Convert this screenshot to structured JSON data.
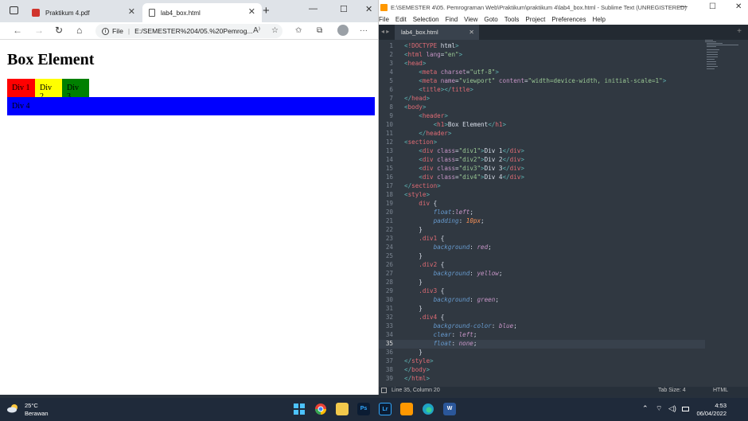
{
  "browser": {
    "tab1": "Praktikum 4.pdf",
    "tab2": "lab4_box.html",
    "url_prefix": "File",
    "url": "E:/SEMESTER%204/05.%20Pemrog...",
    "new_tab": "+",
    "close": "✕",
    "min": "—",
    "max": "☐",
    "back": "←",
    "fwd": "→",
    "refresh": "↻",
    "home": "⌂",
    "more": "···",
    "read_aloud": "A⁾",
    "fav": "☆",
    "favs": "✩",
    "coll": "⧉"
  },
  "page": {
    "heading": "Box Element",
    "div1": "Div 1",
    "div2": "Div 2",
    "div3": "Div 3",
    "div4": "Div 4"
  },
  "sublime": {
    "title": "E:\\SEMESTER 4\\05. Pemrograman Web\\Praktikum\\praktikum 4\\lab4_box.html - Sublime Text (UNREGISTERED)",
    "menu": [
      "File",
      "Edit",
      "Selection",
      "Find",
      "View",
      "Goto",
      "Tools",
      "Project",
      "Preferences",
      "Help"
    ],
    "tab": "lab4_box.html",
    "status_left": "Line 35, Column 20",
    "tab_size": "Tab Size: 4",
    "syntax": "HTML",
    "min": "—",
    "max": "☐",
    "close": "✕",
    "plus": "+",
    "nav": "◂ ▸"
  },
  "colors": {
    "tag": "#e06c75",
    "attr": "#c594c5",
    "str": "#99c794",
    "prop": "#6699cc",
    "val": "#c594c5",
    "num": "#f99157",
    "plain": "#d8dee9",
    "punc": "#5fb3b3"
  },
  "code": [
    "<!DOCTYPE html>",
    "<html lang=\"en\">",
    "<head>",
    "    <meta charset=\"utf-8\">",
    "    <meta name=\"viewport\" content=\"width=device-width, initial-scale=1\">",
    "    <title></title>",
    "</head>",
    "<body>",
    "    <header>",
    "        <h1>Box Element</h1>",
    "    </header>",
    "<section>",
    "    <div class=\"div1\">Div 1</div>",
    "    <div class=\"div2\">Div 2</div>",
    "    <div class=\"div3\">Div 3</div>",
    "    <div class=\"div4\">Div 4</div>",
    "</section>",
    "<style>",
    "    div {",
    "        float:left;",
    "        padding: 10px;",
    "    }",
    "    .div1 {",
    "        background: red;",
    "    }",
    "    .div2 {",
    "        background: yellow;",
    "    }",
    "    .div3 {",
    "        background: green;",
    "    }",
    "    .div4 {",
    "        background-color: blue;",
    "        clear: left;",
    "        float: none;",
    "    }",
    "</style>",
    "</body>",
    "</html>"
  ],
  "taskbar": {
    "temp": "25°C",
    "weather": "Berawan",
    "time": "4:53",
    "date": "06/04/2022",
    "ps": "Ps",
    "lr": "Lr",
    "w": "W",
    "wifi": "⌔",
    "vol": "◁)",
    "chev": "⌃"
  }
}
